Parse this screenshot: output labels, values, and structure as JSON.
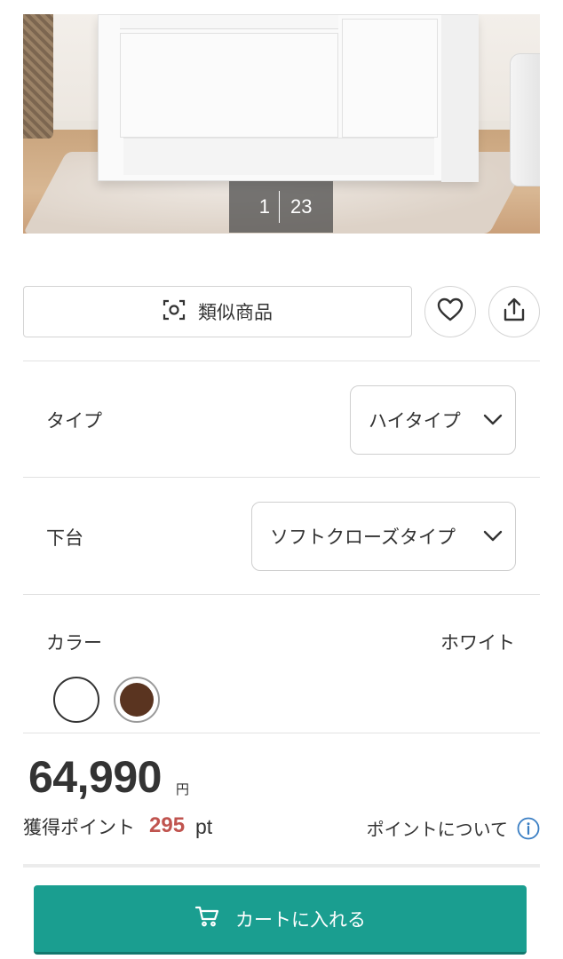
{
  "gallery": {
    "current": "1",
    "total": "23"
  },
  "actions": {
    "similar_label": "類似商品",
    "similar_icon": "camera-scan-icon",
    "favorite_icon": "heart-icon",
    "share_icon": "share-icon"
  },
  "options": [
    {
      "label": "タイプ",
      "value": "ハイタイプ"
    },
    {
      "label": "下台",
      "value": "ソフトクローズタイプ"
    }
  ],
  "color": {
    "label": "カラー",
    "selected": "ホワイト",
    "swatches": [
      {
        "color": "#ffffff",
        "selected": true
      },
      {
        "color": "#5a3420",
        "selected": false
      }
    ]
  },
  "price": {
    "amount": "64,990",
    "unit": "円"
  },
  "points": {
    "label": "獲得ポイント",
    "value": "295",
    "unit": "pt",
    "about_label": "ポイントについて"
  },
  "cart": {
    "label": "カートに入れる",
    "color": "#1a9e90"
  }
}
